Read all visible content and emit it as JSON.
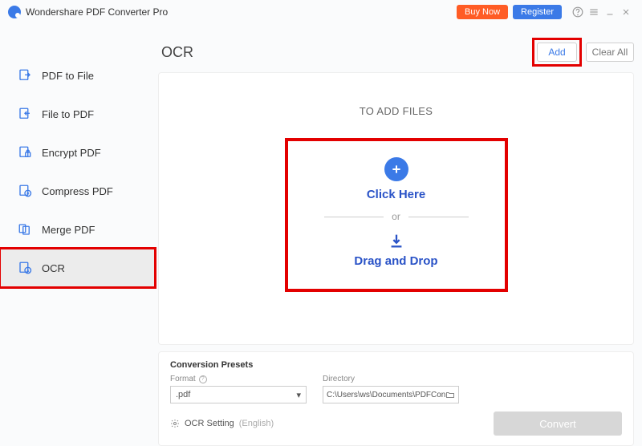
{
  "app": {
    "title": "Wondershare PDF Converter Pro"
  },
  "titlebar": {
    "buy": "Buy Now",
    "register": "Register"
  },
  "sidebar": {
    "items": [
      {
        "label": "PDF to File"
      },
      {
        "label": "File to PDF"
      },
      {
        "label": "Encrypt PDF"
      },
      {
        "label": "Compress PDF"
      },
      {
        "label": "Merge PDF"
      },
      {
        "label": "OCR"
      }
    ]
  },
  "page": {
    "title": "OCR",
    "add": "Add",
    "clear_all": "Clear All"
  },
  "drop": {
    "heading": "TO ADD FILES",
    "click": "Click Here",
    "or": "or",
    "drag": "Drag and Drop"
  },
  "presets": {
    "title": "Conversion Presets",
    "format_label": "Format",
    "format_value": ".pdf",
    "directory_label": "Directory",
    "directory_value": "C:\\Users\\ws\\Documents\\PDFConvert",
    "ocr_setting": "OCR Setting",
    "language": "(English)",
    "convert": "Convert"
  }
}
